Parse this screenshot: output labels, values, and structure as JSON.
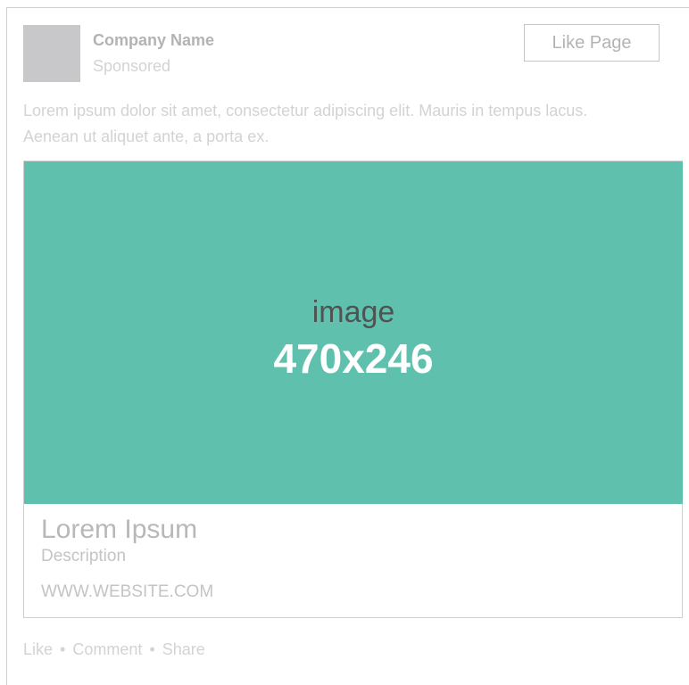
{
  "header": {
    "company_name": "Company Name",
    "sponsored": "Sponsored",
    "like_page": "Like Page"
  },
  "post": {
    "text_line1": "Lorem ipsum dolor sit amet, consectetur adipiscing elit. Mauris in tempus lacus.",
    "text_line2": "Aenean ut aliquet ante, a porta ex."
  },
  "preview": {
    "image_word": "image",
    "image_size": "470x246",
    "title": "Lorem Ipsum",
    "description": "Description",
    "url": "WWW.WEBSITE.COM"
  },
  "actions": {
    "like": "Like",
    "comment": "Comment",
    "share": "Share",
    "separator": "•"
  },
  "colors": {
    "image_placeholder": "#5fc0ad",
    "avatar_placeholder": "#c8c8ca",
    "border": "#cfcfcf"
  }
}
